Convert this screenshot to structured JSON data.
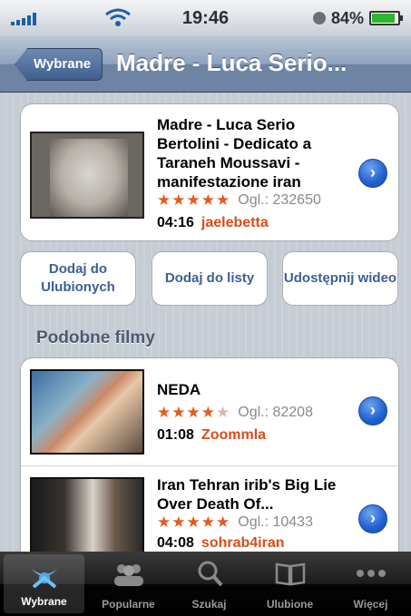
{
  "status_bar": {
    "time": "19:46",
    "battery": "84%",
    "battery_level": 0.84
  },
  "nav": {
    "back_label": "Wybrane",
    "title": "Madre - Luca Serio..."
  },
  "video": {
    "title": "Madre - Luca Serio Bertolini - Dedicato a Taraneh Moussavi - manifestazione iran",
    "stars": 5,
    "views": "Ogl.: 232650",
    "duration": "04:16",
    "author": "jaelebetta"
  },
  "actions": [
    {
      "label": "Dodaj do Ulubionych"
    },
    {
      "label": "Dodaj do listy"
    },
    {
      "label": "Udostępnij wideo"
    }
  ],
  "section": {
    "title": "Podobne filmy"
  },
  "related": [
    {
      "title": "NEDA",
      "stars": 4,
      "views": "Ogl.: 82208",
      "duration": "01:08",
      "author": "Zoommla"
    },
    {
      "title": "Iran Tehran irib's Big Lie Over Death Of...",
      "stars": 5,
      "views": "Ogl.: 10433",
      "duration": "04:08",
      "author": "sohrab4iran"
    }
  ],
  "tabs": [
    {
      "label": "Wybrane",
      "icon": "featured-icon",
      "active": true
    },
    {
      "label": "Popularne",
      "icon": "most-viewed-icon"
    },
    {
      "label": "Szukaj",
      "icon": "search-icon"
    },
    {
      "label": "Ulubione",
      "icon": "bookmarks-icon"
    },
    {
      "label": "Więcej",
      "icon": "more-icon"
    }
  ],
  "colors": {
    "accent": "#3b5f96",
    "author": "#d74d1a",
    "star": "#e55a1f"
  }
}
